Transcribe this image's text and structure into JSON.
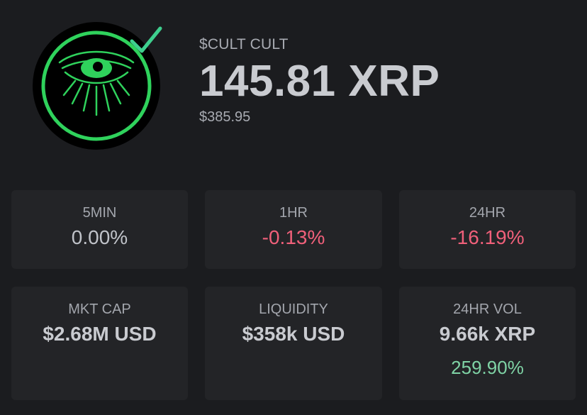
{
  "token": {
    "name": "$CULT CULT",
    "price_xrp": "145.81 XRP",
    "price_usd": "$385.95"
  },
  "changes": [
    {
      "label": "5MIN",
      "value": "0.00%",
      "trend": "neutral"
    },
    {
      "label": "1HR",
      "value": "-0.13%",
      "trend": "negative"
    },
    {
      "label": "24HR",
      "value": "-16.19%",
      "trend": "negative"
    }
  ],
  "stats": {
    "mkt_cap": {
      "label": "MKT CAP",
      "value": "$2.68M USD"
    },
    "liquidity": {
      "label": "LIQUIDITY",
      "value": "$358k USD"
    },
    "vol_24hr": {
      "label": "24HR VOL",
      "value": "9.66k XRP",
      "change": "259.90%"
    }
  },
  "colors": {
    "background": "#1b1c1f",
    "card": "#232427",
    "accent_green": "#2fd25c",
    "verified_check": "#3ecf8e",
    "negative": "#f0607a",
    "positive": "#7fd3a5"
  },
  "icons": {
    "logo": "cult-eye-logo",
    "verified": "verified-check-icon"
  }
}
